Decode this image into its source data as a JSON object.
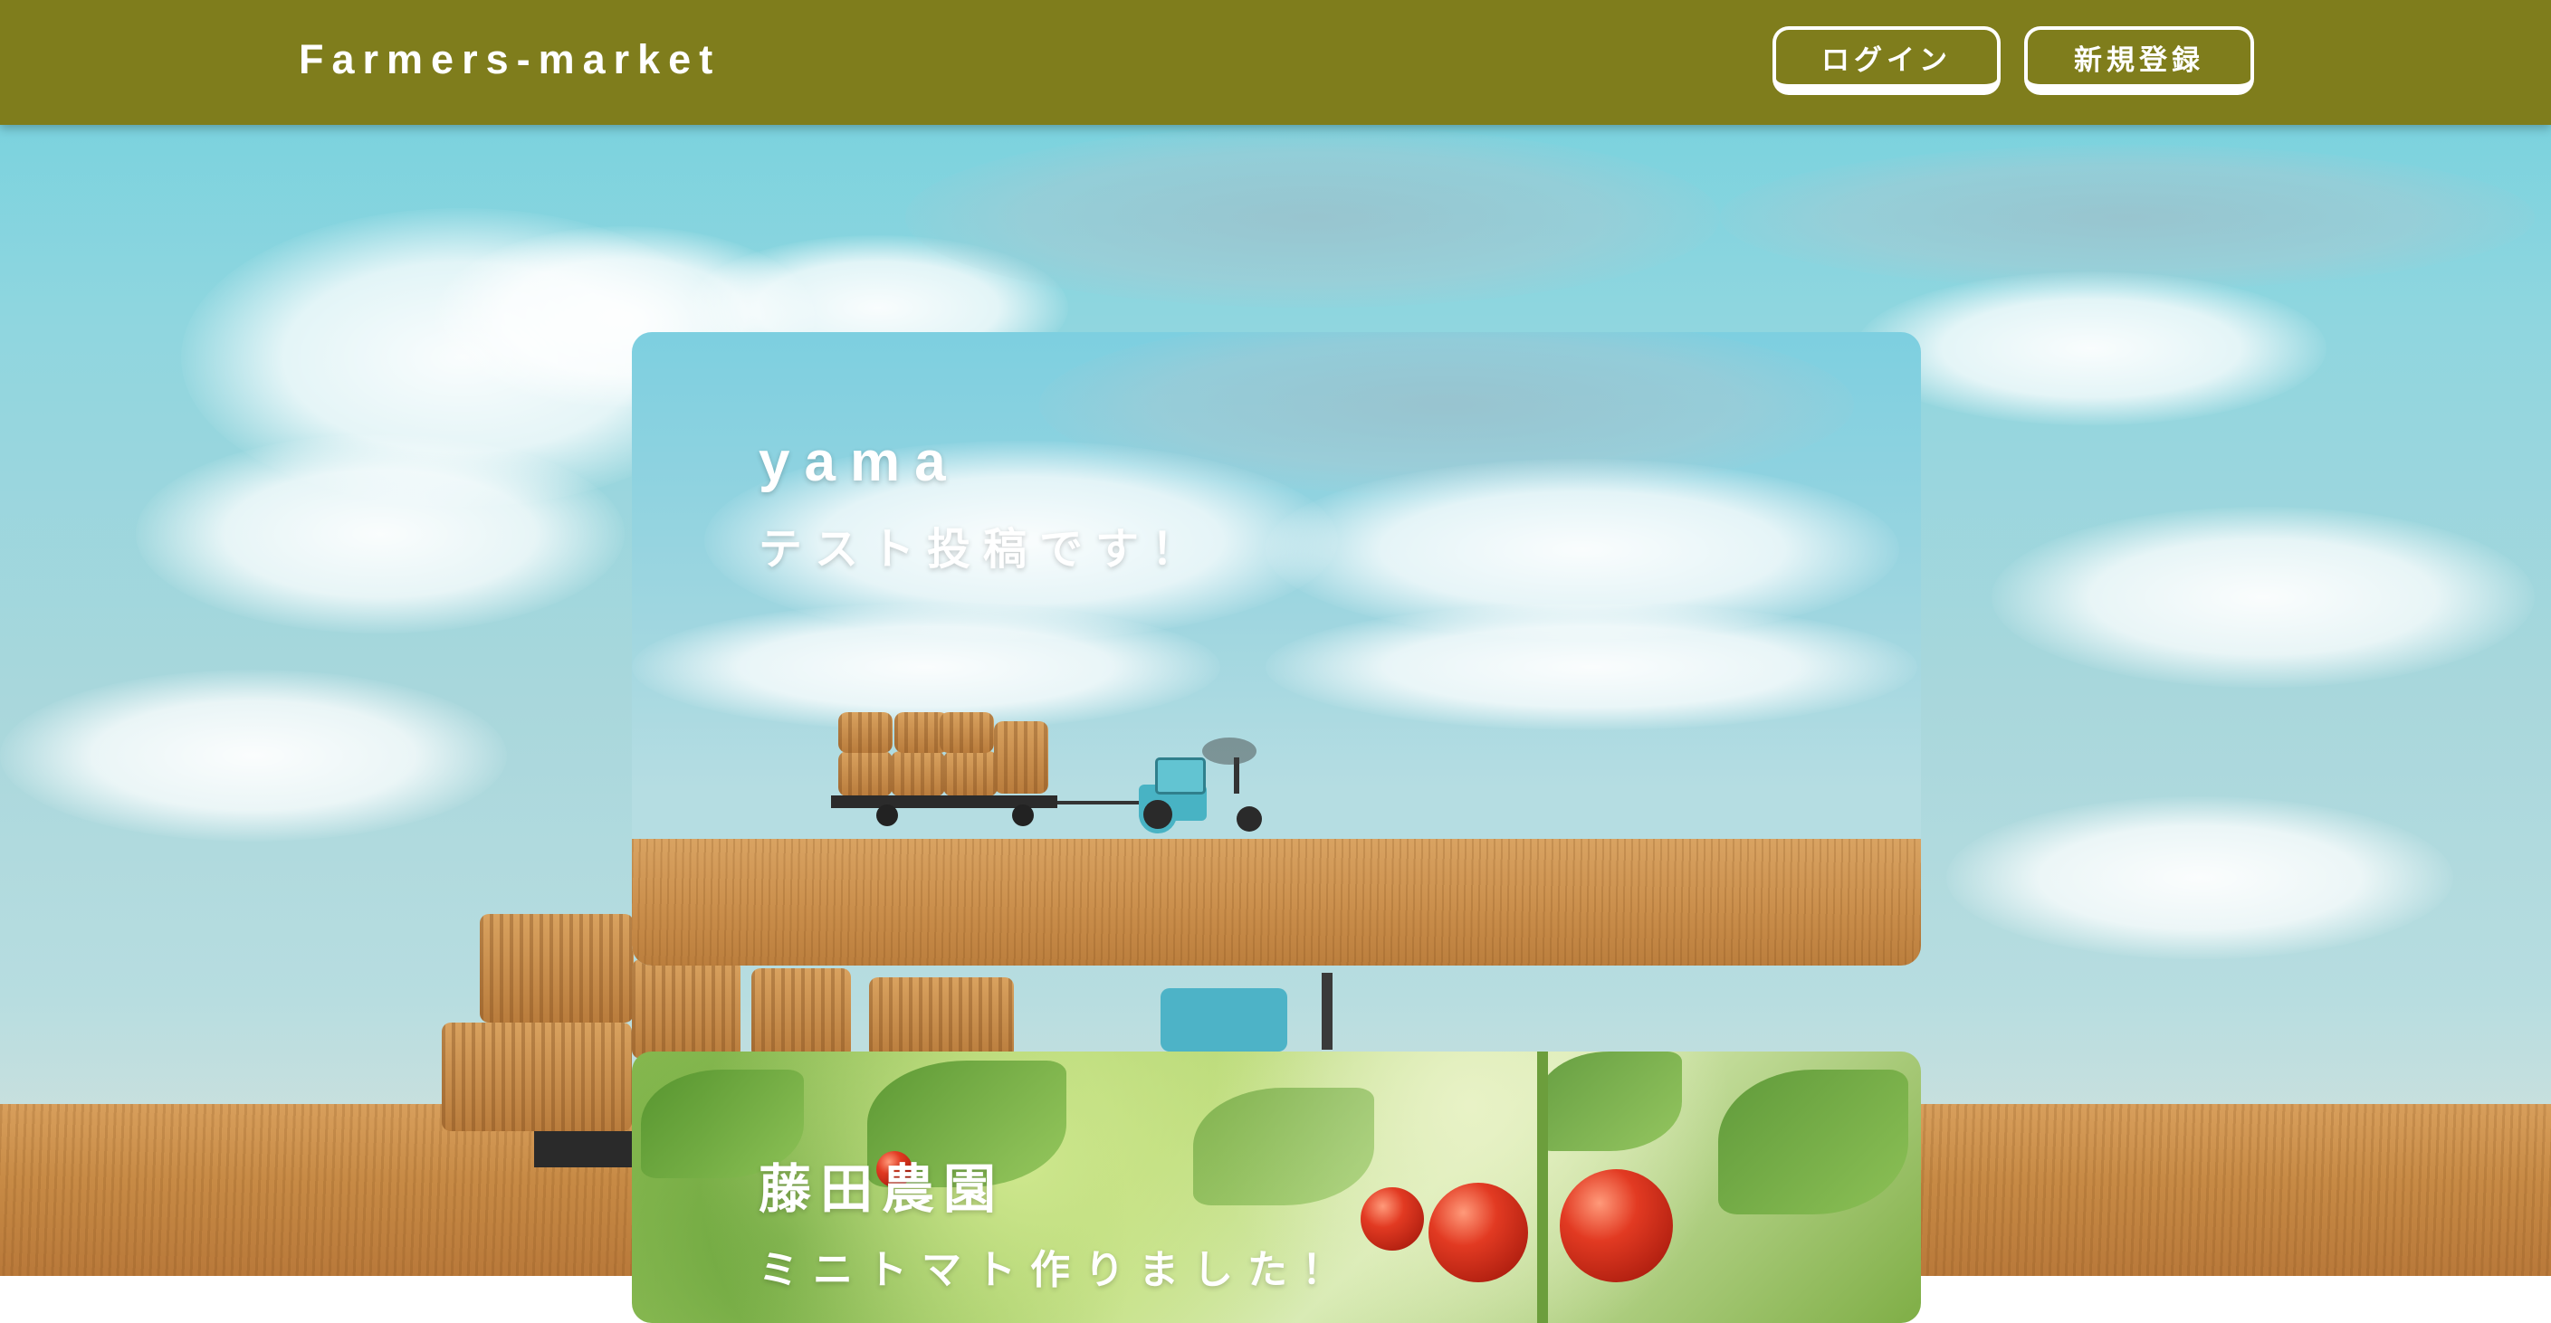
{
  "header": {
    "brand": "Farmers-market",
    "login_label": "ログイン",
    "signup_label": "新規登録",
    "background_color": "#7f7d1c"
  },
  "posts": [
    {
      "user": "yama",
      "text": "テスト投稿です！",
      "image": "tractor-hay-field"
    },
    {
      "user": "藤田農園",
      "text": "ミニトマト作りました！",
      "image": "cherry-tomatoes"
    }
  ],
  "background_image": "tractor-hay-field"
}
